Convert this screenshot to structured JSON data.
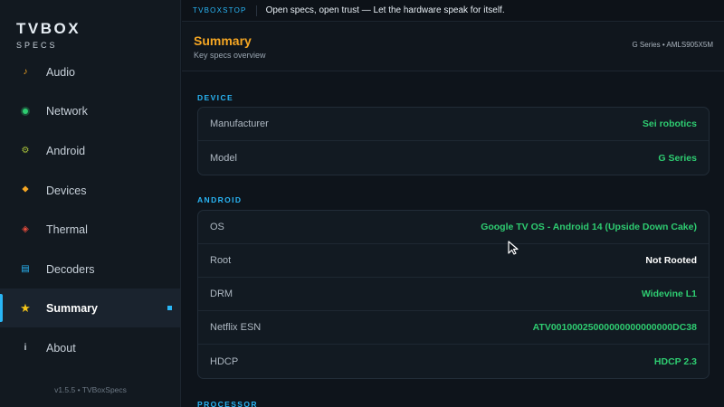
{
  "app": {
    "logo_title": "TVBOX",
    "logo_sub": "SPECS",
    "version": "v1.5.5 • TVBoxSpecs"
  },
  "sidebar": {
    "items": [
      {
        "label": "Audio",
        "icon": "music-note-icon",
        "color": "#f5a623"
      },
      {
        "label": "Network",
        "icon": "network-dot-icon",
        "color": "#2ecc71"
      },
      {
        "label": "Android",
        "icon": "android-gear-icon",
        "color": "#a8c23a"
      },
      {
        "label": "Devices",
        "icon": "devices-diamond-icon",
        "color": "#f5a623"
      },
      {
        "label": "Thermal",
        "icon": "thermal-diamond-icon",
        "color": "#e74c3c"
      },
      {
        "label": "Decoders",
        "icon": "decoder-grid-icon",
        "color": "#29b6f6"
      },
      {
        "label": "Summary",
        "icon": "star-icon",
        "color": "#f5c518",
        "active": true
      },
      {
        "label": "About",
        "icon": "info-icon",
        "color": "#c7d0d9"
      }
    ]
  },
  "ticker": {
    "tag": "TVBOXSTOP",
    "text": "Open specs, open trust — Let the hardware speak for itself."
  },
  "header": {
    "title": "Summary",
    "subtitle": "Key specs overview",
    "meta": "G Series • AMLS905X5M"
  },
  "sections": {
    "device": {
      "label": "DEVICE",
      "rows": [
        {
          "label": "Manufacturer",
          "value": "Sei robotics"
        },
        {
          "label": "Model",
          "value": "G Series"
        }
      ]
    },
    "android": {
      "label": "ANDROID",
      "rows": [
        {
          "label": "OS",
          "value": "Google TV OS - Android 14 (Upside Down Cake)"
        },
        {
          "label": "Root",
          "value": "Not Rooted"
        },
        {
          "label": "DRM",
          "value": "Widevine L1"
        },
        {
          "label": "Netflix ESN",
          "value": "ATV00100025000000000000000DC38"
        },
        {
          "label": "HDCP",
          "value": "HDCP 2.3"
        }
      ]
    },
    "processor": {
      "label": "PROCESSOR"
    }
  },
  "colors": {
    "accent": "#29b6f6",
    "title": "#f5a623",
    "value_green": "#2ecc71"
  }
}
